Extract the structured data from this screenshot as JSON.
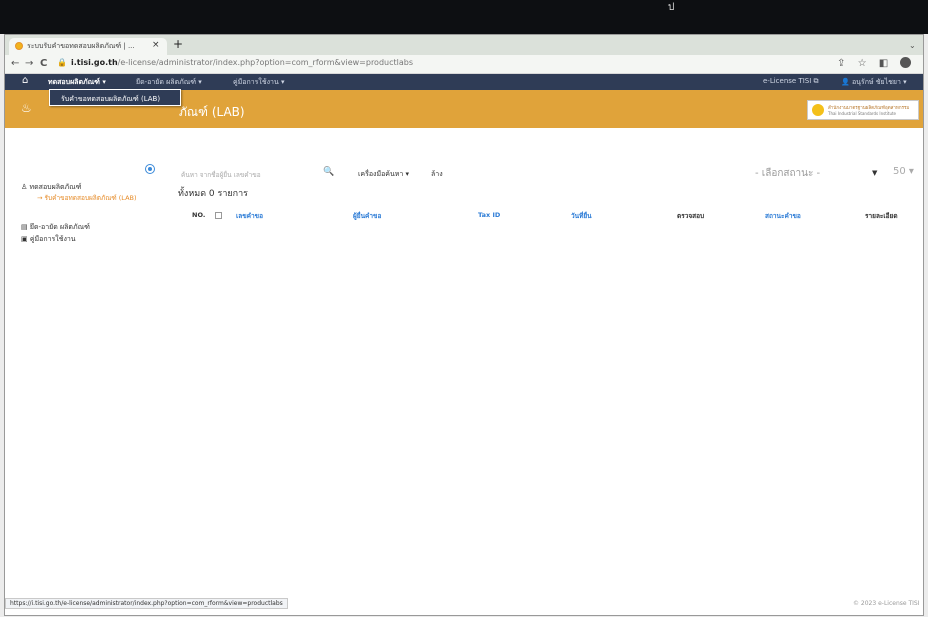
{
  "top_mark": "ป",
  "browser": {
    "tab_title": "ระบบรับคำขอทดสอบผลิตภัณฑ์ | ...",
    "tab_close": "×",
    "new_tab": "+",
    "tab_menu": "⌄",
    "back": "←",
    "forward": "→",
    "reload": "C",
    "lock": "🔒",
    "url_host": "i.tisi.go.th",
    "url_path": "/e-license/administrator/index.php?option=com_rform&view=productlabs",
    "share_icon": "⇪",
    "star_icon": "☆",
    "sidepanel_icon": "◧"
  },
  "adminbar": {
    "home_icon": "⌂",
    "menu1": "ทดสอบผลิตภัณฑ์ ▾",
    "menu2": "ยืด-อายัด ผลิตภัณฑ์ ▾",
    "menu3": "คู่มือการใช้งาน ▾",
    "right1": "e-License TISI ⧉",
    "right2": "👤 อนุรักษ์ ชัยไชยา ▾"
  },
  "dropdown": {
    "item": "รับคำขอทดสอบผลิตภัณฑ์ (LAB)"
  },
  "titlebar": {
    "icon": "♨",
    "title": "ภัณฑ์ (LAB)"
  },
  "brand": {
    "line1": "สำนักงานมาตรฐานผลิตภัณฑ์อุตสาหกรรม",
    "line2": "Thai Industrial Standards Institute"
  },
  "sidebar": {
    "item1": "ทดสอบผลิตภัณฑ์",
    "item1_icon": "♙",
    "sub1": "→ รับคำขอทดสอบผลิตภัณฑ์ (LAB)",
    "item2": "ยึด-อายัด ผลิตภัณฑ์",
    "item2_icon": "▤",
    "item3": "คู่มือการใช้งาน",
    "item3_icon": "▣"
  },
  "main": {
    "search_placeholder": "ค้นหา จากชื่อผู้ยื่น เลขคำขอ",
    "search_icon": "🔍",
    "tools_label": "เครื่องมือค้นหา ▾",
    "clear_label": "ล้าง",
    "status_select": "- เลือกสถานะ -",
    "status_arrow": "▼",
    "limit_select": "50 ▾",
    "total": "ทั้งหมด 0 รายการ",
    "columns": [
      "NO.",
      "เลขคำขอ",
      "ผู้ยื่นคำขอ",
      "Tax ID",
      "วันที่ยื่น",
      "ตรวจสอบ",
      "สถานะคำขอ",
      "รายละเอียด"
    ]
  },
  "footer": {
    "status_url": "https://i.tisi.go.th/e-license/administrator/index.php?option=com_rform&view=productlabs",
    "copyright": "© 2023 e-License TISI"
  }
}
